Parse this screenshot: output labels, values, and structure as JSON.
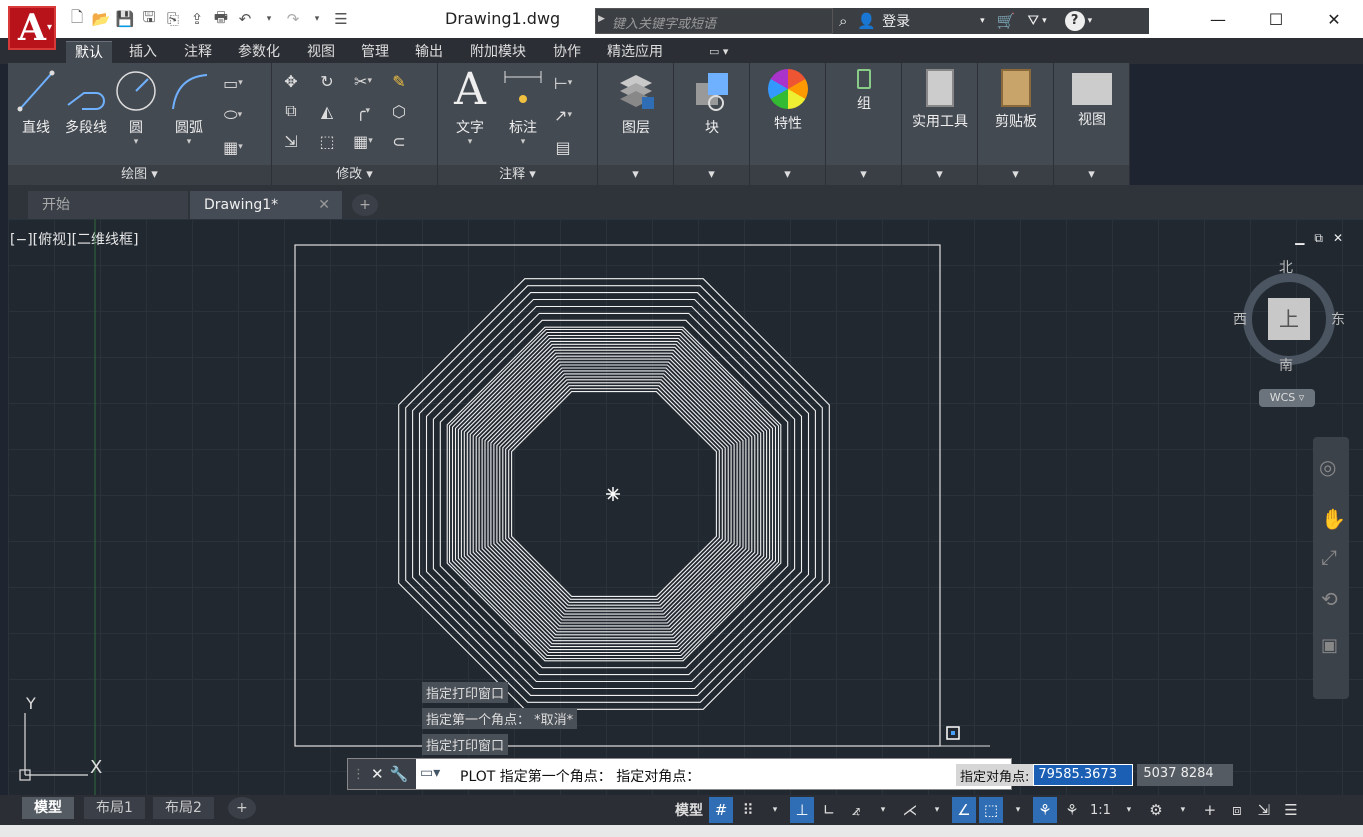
{
  "app": {
    "logo_letter": "A",
    "doc_title": "Drawing1.dwg"
  },
  "search": {
    "placeholder": "键入关键字或短语"
  },
  "infocenter": {
    "login_label": "登录"
  },
  "ribbon_tabs": [
    "默认",
    "插入",
    "注释",
    "参数化",
    "视图",
    "管理",
    "输出",
    "附加模块",
    "协作",
    "精选应用"
  ],
  "active_ribbon_tab": "默认",
  "panels": {
    "draw": {
      "title": "绘图",
      "line": "直线",
      "polyline": "多段线",
      "circle": "圆",
      "arc": "圆弧"
    },
    "modify": {
      "title": "修改"
    },
    "annotate": {
      "title": "注释",
      "text": "文字",
      "dimension": "标注"
    },
    "layers": "图层",
    "block": "块",
    "properties": "特性",
    "group": "组",
    "utilities": "实用工具",
    "clipboard": "剪贴板",
    "view": "视图"
  },
  "file_tabs": {
    "start": "开始",
    "drawing": "Drawing1*"
  },
  "viewport": {
    "label": "[−][俯视][二维线框]"
  },
  "viewcube": {
    "north": "北",
    "south": "南",
    "east": "东",
    "west": "西",
    "top": "上",
    "wcs": "WCS"
  },
  "ucs": {
    "x": "X",
    "y": "Y"
  },
  "command_history": [
    "指定打印窗口",
    "指定第一个角点： *取消*",
    "指定打印窗口"
  ],
  "command_line": {
    "text": "PLOT 指定第一个角点： 指定对角点："
  },
  "dynamic_input": {
    "label": "指定对角点:",
    "x_value": "79585.3673",
    "y_value": "5037 8284"
  },
  "layout_tabs": [
    "模型",
    "布局1",
    "布局2"
  ],
  "status": {
    "model_label": "模型",
    "scale": "1:1"
  },
  "colors": {
    "accent": "#2f6eb5",
    "logo": "#b8121b"
  }
}
